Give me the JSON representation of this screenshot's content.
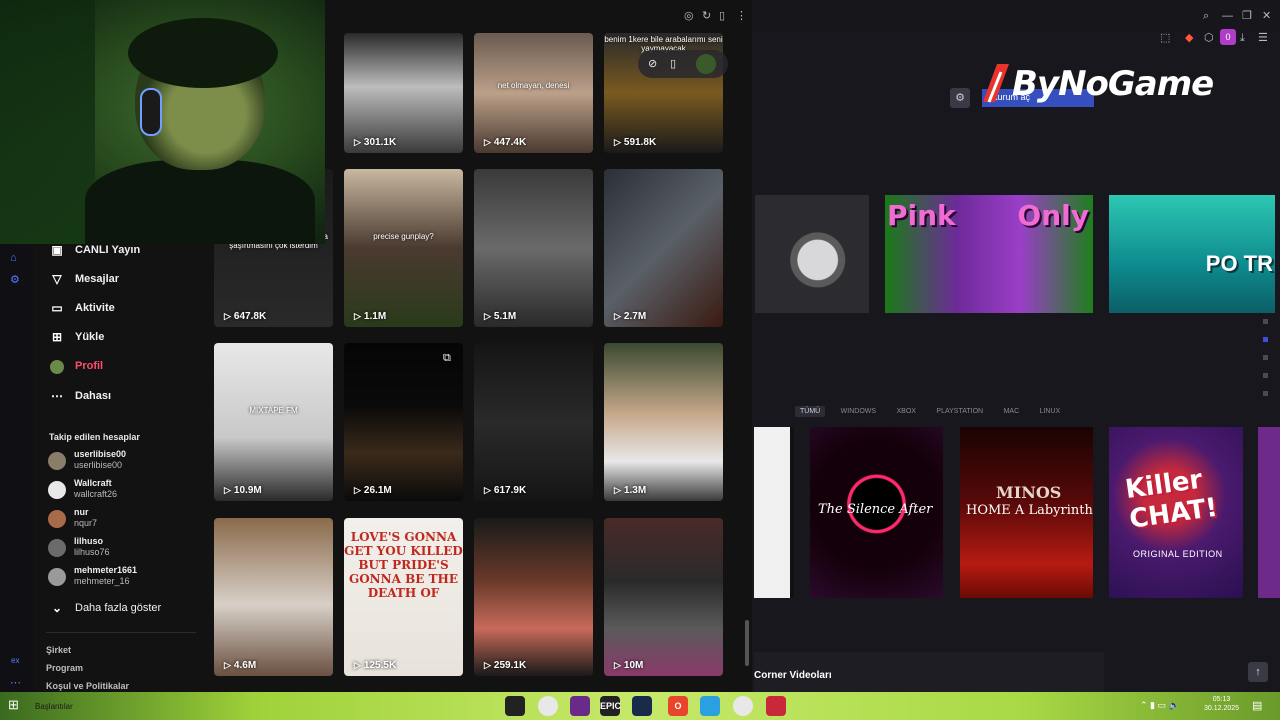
{
  "right": {
    "logo_text": "ByNoGame",
    "logo_underlay_text": "Oturum aç",
    "notification_count": "0",
    "banners": [
      {
        "id": "ban1",
        "text": ""
      },
      {
        "id": "ban2",
        "text_left": "Pink",
        "text_right": "Only"
      },
      {
        "id": "ban3",
        "text": "PO TR"
      }
    ],
    "filters": [
      "TÜMÜ",
      "WINDOWS",
      "XBOX",
      "PLAYSTATION",
      "MAC",
      "LINUX"
    ],
    "games": [
      {
        "title": "The Silence After"
      },
      {
        "title1": "MINOS",
        "title2": "HOME A Labyrinth"
      },
      {
        "title1": "Killer CHAT!",
        "title2": "ORIGINAL EDITION"
      }
    ],
    "section_title": "Corner Videoları",
    "to_top_icon": "arrow-up-icon"
  },
  "left": {
    "nav": [
      {
        "icon": "live-icon",
        "label": "CANLI Yayın"
      },
      {
        "icon": "messages-icon",
        "label": "Mesajlar"
      },
      {
        "icon": "activity-icon",
        "label": "Aktivite"
      },
      {
        "icon": "upload-icon",
        "label": "Yükle"
      },
      {
        "icon": "profile-avatar-icon",
        "label": "Profil"
      },
      {
        "icon": "more-icon",
        "label": "Dahası"
      }
    ],
    "following_title": "Takip edilen hesaplar",
    "accounts": [
      {
        "name": "userlibise00",
        "handle": "userlibise00",
        "color": "#8a7d6a"
      },
      {
        "name": "Wallcraft",
        "handle": "wallcraft26",
        "color": "#e8e8e8"
      },
      {
        "name": "nur",
        "handle": "nqur7",
        "color": "#a86b4a"
      },
      {
        "name": "lilhuso",
        "handle": "lilhuso76",
        "color": "#6b6b6b"
      },
      {
        "name": "mehmeter1661",
        "handle": "mehmeter_16",
        "color": "#9a9a9a"
      }
    ],
    "show_more": "Daha fazla göster",
    "footer": [
      "Şirket",
      "Program",
      "Koşul ve Politikalar"
    ],
    "leftbar_label": "ex",
    "videos": [
      {
        "views": "301.1K",
        "caption": "",
        "bg": "linear-gradient(180deg,#2a2a2a,#bdbdbd 45%,#3a3a3a)"
      },
      {
        "views": "447.4K",
        "caption": "net olmayan, denesi",
        "bg": "linear-gradient(180deg,#6a5a50,#bca08a 50%,#4a3a30)"
      },
      {
        "views": "591.8K",
        "caption": "benim 1kere bile arabalarımı seni yaymayacak",
        "bg": "linear-gradient(180deg,#2a2a2a,#7a5a20 50%,#1a1a1a)"
      },
      {
        "views": "647.8K",
        "caption": "şüphelerin miş şaşırtmadı ama şaşırtmasını çok isterdim",
        "bg": "linear-gradient(180deg,#1a1a1a,#2a2a2a)"
      },
      {
        "views": "1.1M",
        "caption": "precise gunplay?",
        "bg": "linear-gradient(180deg,#c9b8a0,#4a3a30 50%,#2a3a1a)"
      },
      {
        "views": "5.1M",
        "caption": "",
        "bg": "linear-gradient(180deg,#3a3a3a,#6a6a6a 50%,#2a2a2a)"
      },
      {
        "views": "2.7M",
        "caption": "",
        "bg": "linear-gradient(135deg,#2a2f38,#5a6068 50%,#3a1a10)"
      },
      {
        "views": "10.9M",
        "caption": "MIXTAPE FM",
        "bg": "linear-gradient(180deg,#e8e8e8,#c8c8c8 60%,#2a2a2a)"
      },
      {
        "views": "26.1M",
        "caption": "",
        "bg": "linear-gradient(180deg,#050505,#0a0a0a 40%,#3a2a1a 70%,#0a0a0a)"
      },
      {
        "views": "617.9K",
        "caption": "",
        "bg": "linear-gradient(180deg,#151515,#2a2a2a 50%,#151515)"
      },
      {
        "views": "1.3M",
        "caption": "",
        "bg": "linear-gradient(180deg,#3a4a30,#c7a88a 45%,#e8e8e8 75%,#3a3a3a)"
      },
      {
        "views": "4.6M",
        "caption": "",
        "bg": "linear-gradient(180deg,#8a6a4a,#d8d0c8 55%,#6a5040)"
      },
      {
        "views": "125.5K",
        "caption": "LOVE'S GONNA GET YOU KILLED BUT PRIDE'S GONNA BE THE DEATH OF",
        "bg": "linear-gradient(180deg,#f2f0ec,#e8e2da)"
      },
      {
        "views": "259.1K",
        "caption": "",
        "bg": "linear-gradient(180deg,#1a1a1a,#6a3a2a 40%,#c86a5a 70%,#1a1a1a)"
      },
      {
        "views": "10M",
        "caption": "",
        "bg": "linear-gradient(180deg,#4a2a28,#2a2a2a 40%,#5a5a5a 70%,#8a3a6a)"
      }
    ]
  },
  "taskbar": {
    "bookmarks_label": "Başlantılar",
    "apps": [
      {
        "icon": "browser-icon",
        "label": ""
      },
      {
        "icon": "chrome-icon",
        "label": ""
      },
      {
        "icon": "twitch-icon",
        "label": ""
      },
      {
        "icon": "epic-games-icon",
        "label": "EPIC"
      },
      {
        "icon": "steam-icon",
        "label": ""
      },
      {
        "icon": "opera-icon",
        "label": "O"
      },
      {
        "icon": "telegram-icon",
        "label": ""
      },
      {
        "icon": "chrome-alt-icon",
        "label": ""
      },
      {
        "icon": "app-icon",
        "label": ""
      }
    ],
    "time": "05:13",
    "date": "30.12.2025"
  }
}
